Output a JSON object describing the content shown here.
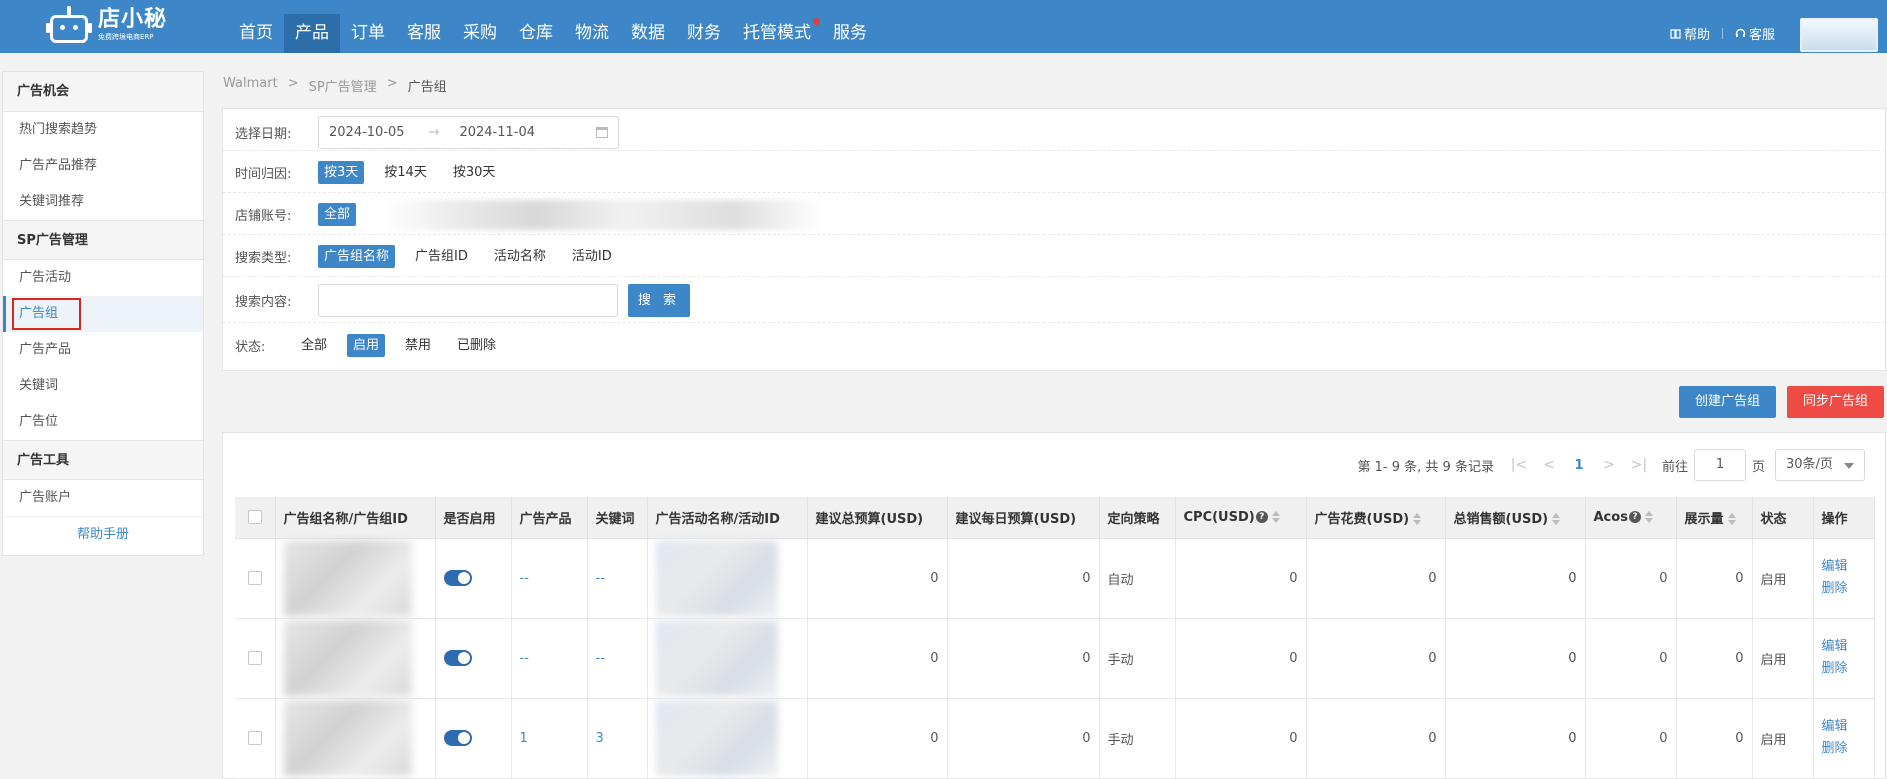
{
  "brand": {
    "name": "店小秘",
    "tagline": "免费跨境电商ERP"
  },
  "nav": [
    {
      "label": "首页",
      "active": false
    },
    {
      "label": "产品",
      "active": true
    },
    {
      "label": "订单",
      "active": false
    },
    {
      "label": "客服",
      "active": false
    },
    {
      "label": "采购",
      "active": false
    },
    {
      "label": "仓库",
      "active": false
    },
    {
      "label": "物流",
      "active": false
    },
    {
      "label": "数据",
      "active": false
    },
    {
      "label": "财务",
      "active": false
    },
    {
      "label": "托管模式",
      "active": false,
      "dot": true
    },
    {
      "label": "服务",
      "active": false
    }
  ],
  "top_right": {
    "help": "帮助",
    "service": "客服"
  },
  "sidebar": {
    "groups": [
      {
        "title": "广告机会",
        "items": [
          "热门搜索趋势",
          "广告产品推荐",
          "关键词推荐"
        ]
      },
      {
        "title": "SP广告管理",
        "items": [
          "广告活动",
          "广告组",
          "广告产品",
          "关键词",
          "广告位"
        ]
      },
      {
        "title": "广告工具",
        "items": [
          "广告账户"
        ]
      }
    ],
    "active_item": "广告组",
    "help": "帮助手册"
  },
  "breadcrumb": [
    "Walmart",
    ">",
    "SP广告管理",
    ">",
    "广告组"
  ],
  "filters": {
    "date_label": "选择日期:",
    "date_start": "2024-10-05",
    "date_arrow": "→",
    "date_end": "2024-11-04",
    "attr_label": "时间归因:",
    "attr_options": [
      "按3天",
      "按14天",
      "按30天"
    ],
    "attr_selected": 0,
    "store_label": "店铺账号:",
    "store_all": "全部",
    "search_type_label": "搜索类型:",
    "search_types": [
      "广告组名称",
      "广告组ID",
      "活动名称",
      "活动ID"
    ],
    "search_type_selected": 0,
    "search_content_label": "搜索内容:",
    "search_value": "",
    "search_button": "搜 索",
    "status_label": "状态:",
    "status_options": [
      "全部",
      "启用",
      "禁用",
      "已删除"
    ],
    "status_selected": 1
  },
  "actions": {
    "create": "创建广告组",
    "sync": "同步广告组"
  },
  "pager": {
    "summary": "第 1- 9 条, 共 9 条记录",
    "current_page": "1",
    "goto_label": "前往",
    "goto_value": "1",
    "page_unit": "页",
    "page_size": "30条/页"
  },
  "table": {
    "columns": [
      "广告组名称/广告组ID",
      "是否启用",
      "广告产品",
      "关键词",
      "广告活动名称/活动ID",
      "建议总预算(USD)",
      "建议每日预算(USD)",
      "定向策略",
      "CPC(USD)",
      "广告花费(USD)",
      "总销售额(USD)",
      "Acos",
      "展示量",
      "状态",
      "操作"
    ],
    "rows": [
      {
        "product": "--",
        "keyword": "--",
        "total_budget": "0",
        "daily_budget": "0",
        "targeting": "自动",
        "cpc": "0",
        "spend": "0",
        "sales": "0",
        "acos": "0",
        "impressions": "0",
        "status": "启用",
        "edit": "编辑",
        "delete": "删除"
      },
      {
        "product": "--",
        "keyword": "--",
        "total_budget": "0",
        "daily_budget": "0",
        "targeting": "手动",
        "cpc": "0",
        "spend": "0",
        "sales": "0",
        "acos": "0",
        "impressions": "0",
        "status": "启用",
        "edit": "编辑",
        "delete": "删除"
      },
      {
        "product": "1",
        "keyword": "3",
        "total_budget": "0",
        "daily_budget": "0",
        "targeting": "手动",
        "cpc": "0",
        "spend": "0",
        "sales": "0",
        "acos": "0",
        "impressions": "0",
        "status": "启用",
        "edit": "编辑",
        "delete": "删除"
      }
    ]
  },
  "colors": {
    "primary": "#3d87c9",
    "danger": "#ee4b45",
    "topbar": "#3d87c9"
  }
}
